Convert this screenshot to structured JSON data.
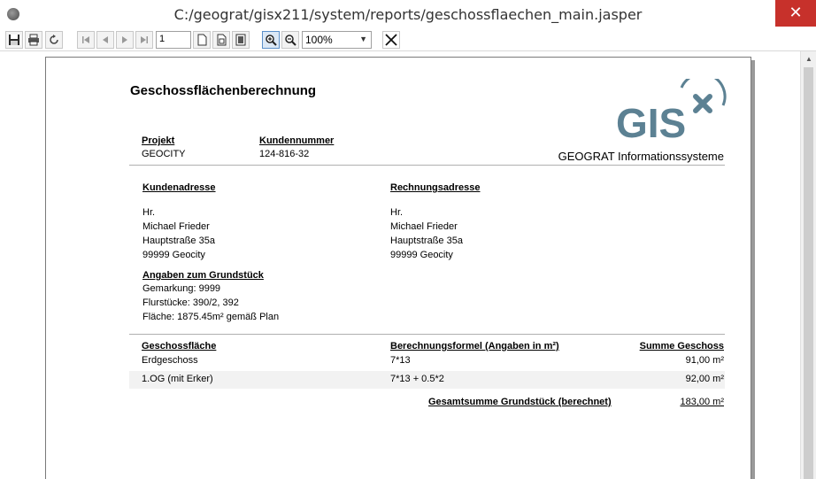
{
  "window": {
    "title": "C:/geograt/gisx211/system/reports/geschossflaechen_main.jasper",
    "close_glyph": "✕"
  },
  "toolbar": {
    "page_number": "1",
    "zoom": "100%"
  },
  "report": {
    "title": "Geschossflächenberechnung",
    "project_label": "Projekt",
    "project_value": "GEOCITY",
    "customer_no_label": "Kundennummer",
    "customer_no_value": "124-816-32",
    "logo_text": "GIS",
    "company_name": "GEOGRAT Informationssysteme",
    "customer_address": {
      "label": "Kundenadresse",
      "lines": [
        "Hr.",
        "Michael Frieder",
        "Hauptstraße 35a",
        "99999 Geocity"
      ]
    },
    "billing_address": {
      "label": "Rechnungsadresse",
      "lines": [
        "Hr.",
        "Michael Frieder",
        "Hauptstraße 35a",
        "99999 Geocity"
      ]
    },
    "plot": {
      "label": "Angaben zum Grundstück",
      "lines": [
        "Gemarkung: 9999",
        "Flurstücke: 390/2, 392",
        "Fläche: 1875.45m² gemäß Plan"
      ]
    },
    "table": {
      "columns": [
        "Geschossfläche",
        "Berechnungsformel (Angaben in m²)",
        "Summe Geschoss"
      ],
      "rows": [
        {
          "floor": "Erdgeschoss",
          "formula": "7*13",
          "sum": "91,00 m²"
        },
        {
          "floor": "1.OG (mit Erker)",
          "formula": "7*13 + 0.5*2",
          "sum": "92,00 m²"
        }
      ],
      "total_label": "Gesamtsumme Grundstück (berechnet)",
      "total_value": "183,00 m²"
    }
  },
  "colors": {
    "logo": "#5c8193",
    "close": "#c7312b"
  }
}
